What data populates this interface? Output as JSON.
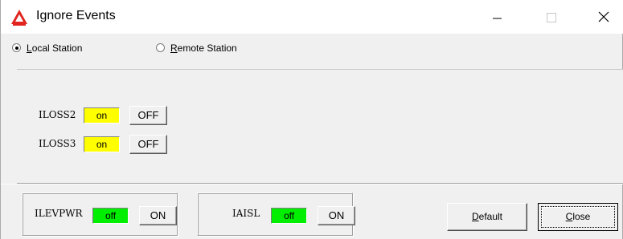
{
  "window": {
    "title": "Ignore Events",
    "app_icon": "red-triangle-logo-icon",
    "controls": {
      "minimize": "minimize-icon",
      "maximize": "maximize-icon",
      "close": "close-icon"
    }
  },
  "station_mode": {
    "options": [
      {
        "accel": "L",
        "rest": "ocal Station",
        "selected": true
      },
      {
        "accel": "R",
        "rest": "emote Station",
        "selected": false
      }
    ]
  },
  "events": [
    {
      "name": "ILOSS2",
      "state": "on",
      "toggle_label": "OFF"
    },
    {
      "name": "ILOSS3",
      "state": "on",
      "toggle_label": "OFF"
    }
  ],
  "bottom_events": [
    {
      "name": "ILEVPWR",
      "state": "off",
      "toggle_label": "ON"
    },
    {
      "name": "IAISL",
      "state": "off",
      "toggle_label": "ON"
    }
  ],
  "buttons": {
    "default": {
      "accel": "D",
      "rest": "efault"
    },
    "close": {
      "accel": "C",
      "rest": "lose"
    }
  },
  "colors": {
    "on_state": "#ffff00",
    "off_state": "#00ee00",
    "logo_red": "#e0261f"
  }
}
